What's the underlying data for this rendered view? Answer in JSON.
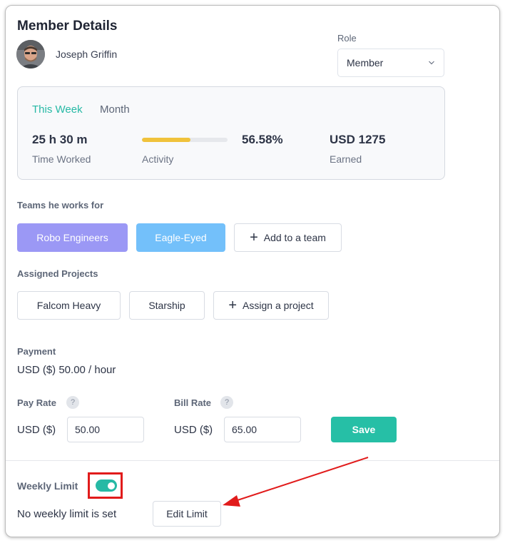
{
  "header": {
    "title": "Member Details"
  },
  "member": {
    "name": "Joseph Griffin"
  },
  "role": {
    "label": "Role",
    "value": "Member"
  },
  "stats": {
    "tabs": [
      {
        "label": "This Week",
        "active": true
      },
      {
        "label": "Month",
        "active": false
      }
    ],
    "time_worked": {
      "value": "25 h 30 m",
      "label": "Time Worked"
    },
    "activity": {
      "value": "56.58%",
      "label": "Activity",
      "fraction": 0.5658
    },
    "earned": {
      "value": "USD 1275",
      "label": "Earned"
    }
  },
  "teams": {
    "label": "Teams he works for",
    "items": [
      "Robo Engineers",
      "Eagle-Eyed"
    ],
    "add_label": "Add to a team"
  },
  "projects": {
    "label": "Assigned Projects",
    "items": [
      "Falcom Heavy",
      "Starship"
    ],
    "assign_label": "Assign a project"
  },
  "payment": {
    "label": "Payment",
    "value": "USD ($) 50.00 / hour",
    "pay_rate": {
      "label": "Pay Rate",
      "currency": "USD ($)",
      "value": "50.00"
    },
    "bill_rate": {
      "label": "Bill Rate",
      "currency": "USD ($)",
      "value": "65.00"
    },
    "help_glyph": "?",
    "save_label": "Save"
  },
  "weekly_limit": {
    "label": "Weekly Limit",
    "enabled": true,
    "status": "No weekly limit is set",
    "edit_label": "Edit Limit"
  },
  "colors": {
    "accent": "#26bfa6",
    "activity_bar": "#f0c23b",
    "team_purple": "#9b98f5",
    "team_blue": "#73c0fa",
    "annotation_red": "#e11b1b"
  }
}
